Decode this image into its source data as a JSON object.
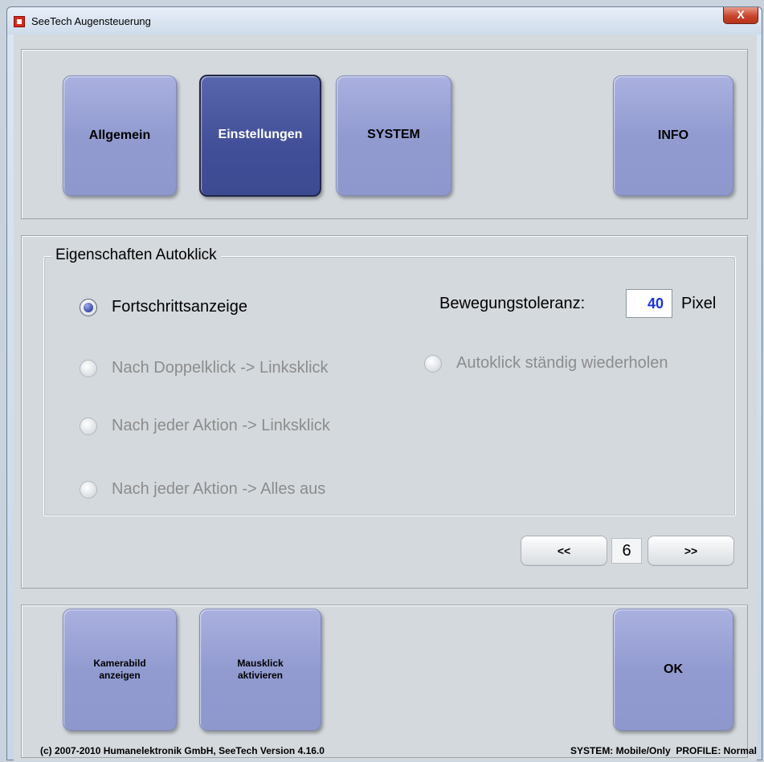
{
  "window": {
    "title": "SeeTech Augensteuerung",
    "close_label": "X"
  },
  "tabs": [
    {
      "label": "Allgemein",
      "active": false
    },
    {
      "label": "Einstellungen",
      "active": true
    },
    {
      "label": "SYSTEM",
      "active": false
    },
    {
      "label": "INFO",
      "active": false
    }
  ],
  "autoklick": {
    "group_title": "Eigenschaften Autoklick",
    "options": [
      {
        "label": "Fortschrittsanzeige",
        "checked": true,
        "enabled": true
      },
      {
        "label": "Nach Doppelklick -> Linksklick",
        "checked": false,
        "enabled": false
      },
      {
        "label": "Nach jeder Aktion -> Linksklick",
        "checked": false,
        "enabled": false
      },
      {
        "label": "Nach jeder Aktion -> Alles aus",
        "checked": false,
        "enabled": false
      },
      {
        "label": "Autoklick ständig wiederholen",
        "checked": false,
        "enabled": false
      }
    ],
    "tolerance_label": "Bewegungstoleranz:",
    "tolerance_value": "40",
    "tolerance_unit": "Pixel"
  },
  "pager": {
    "prev_label": "<<",
    "page": "6",
    "next_label": ">>"
  },
  "bottom": {
    "camera_label": "Kamerabild\nanzeigen",
    "mouseclick_label": "Mausklick\naktivieren",
    "ok_label": "OK"
  },
  "footer": {
    "copyright": "(c) 2007-2010 Humanelektronik GmbH, SeeTech Version 4.16.0",
    "status": "SYSTEM: Mobile/Only  PROFILE: Normal"
  },
  "colors": {
    "button": "#969fd3",
    "button_active": "#414f98",
    "tolerance_value": "#1a32e0",
    "disabled_text": "#8c8c8c"
  }
}
